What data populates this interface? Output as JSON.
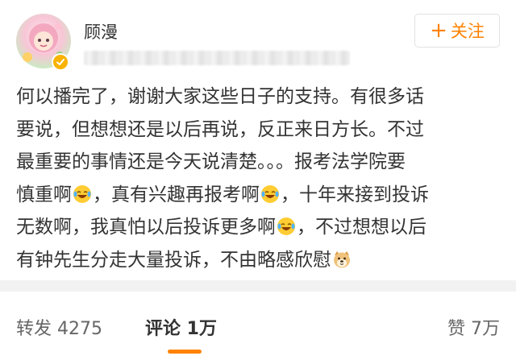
{
  "author": {
    "name": "顾漫",
    "verified": true
  },
  "follow_button": {
    "plus": "+",
    "label": "关注",
    "color": "#ff8200"
  },
  "post": {
    "lines": [
      "何以播完了，谢谢大家这些日子的支持。有很多话",
      "要说，但想想还是以后再说，反正来日方长。不过",
      "最重要的事情还是今天说清楚。。。报考法学院要",
      [
        "慎重啊",
        "，真有兴趣再报考啊",
        "，十年来接到投诉"
      ],
      [
        "无数啊，我真怕以后投诉更多啊",
        "，不过想想以后"
      ],
      "有钟先生分走大量投诉，不由略感欣慰"
    ],
    "emoji_icons": [
      "laughing-tears-emoji",
      "doge-emoji"
    ]
  },
  "actions": {
    "repost": "转发 4275",
    "comment": "评论 1万",
    "like": "赞 7万",
    "active_tab": "comment",
    "accent": "#ff8200"
  }
}
